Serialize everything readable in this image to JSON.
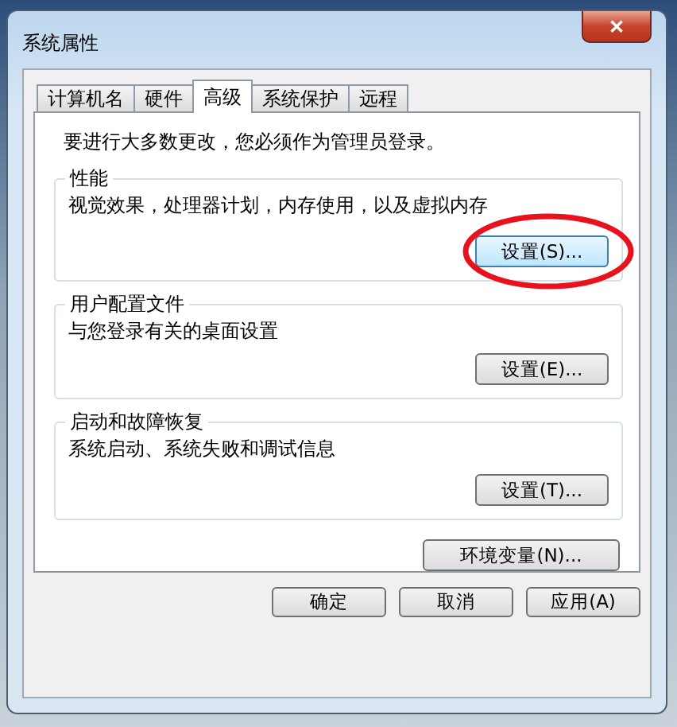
{
  "window": {
    "title": "系统属性",
    "close": "✕"
  },
  "tabs": [
    {
      "label": "计算机名",
      "selected": false
    },
    {
      "label": "硬件",
      "selected": false
    },
    {
      "label": "高级",
      "selected": true
    },
    {
      "label": "系统保护",
      "selected": false
    },
    {
      "label": "远程",
      "selected": false
    }
  ],
  "notice": "要进行大多数更改，您必须作为管理员登录。",
  "groups": [
    {
      "title": "性能",
      "description": "视觉效果，处理器计划，内存使用，以及虚拟内存",
      "button": "设置(S)...",
      "highlighted": true,
      "circled": true
    },
    {
      "title": "用户配置文件",
      "description": "与您登录有关的桌面设置",
      "button": "设置(E)...",
      "highlighted": false,
      "circled": false
    },
    {
      "title": "启动和故障恢复",
      "description": "系统启动、系统失败和调试信息",
      "button": "设置(T)...",
      "highlighted": false,
      "circled": false
    }
  ],
  "env_button": "环境变量(N)...",
  "buttons": [
    "确定",
    "取消",
    "应用(A)"
  ]
}
